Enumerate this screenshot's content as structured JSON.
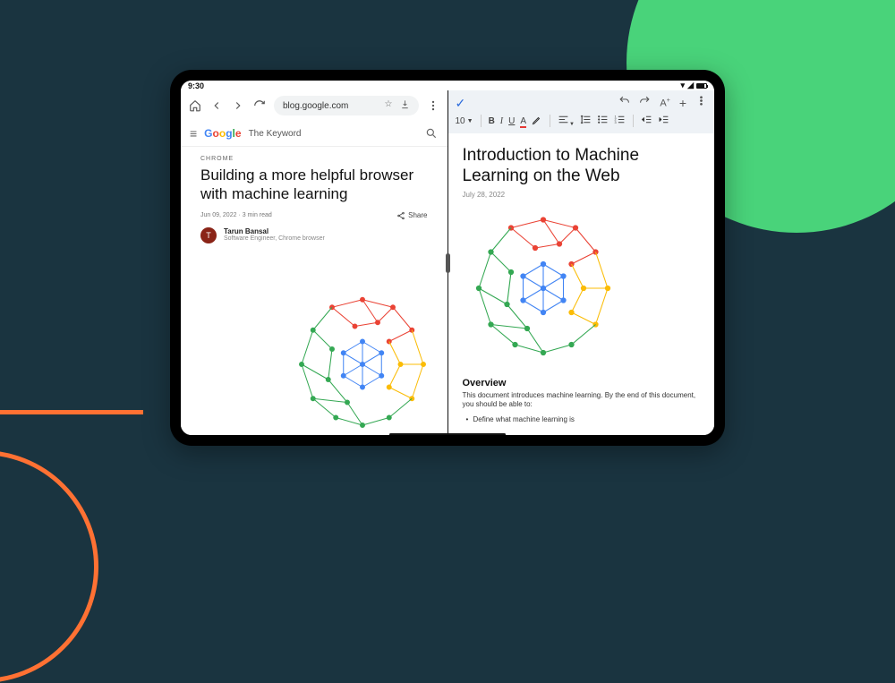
{
  "status": {
    "time": "9:30"
  },
  "browser": {
    "url": "blog.google.com",
    "site_name": "The Keyword",
    "article": {
      "category": "CHROME",
      "headline": "Building a more helpful browser with machine learning",
      "date": "Jun 09, 2022",
      "read_time": "3 min read",
      "share_label": "Share",
      "author": {
        "initial": "T",
        "name": "Tarun Bansal",
        "role": "Software Engineer, Chrome browser"
      }
    }
  },
  "docs": {
    "font_size": "10",
    "title": "Introduction to Machine Learning on the Web",
    "date": "July 28, 2022",
    "section_heading": "Overview",
    "paragraph": "This document introduces machine learning. By the end of this document, you should be able to:",
    "bullet1": "Define what machine learning is"
  }
}
